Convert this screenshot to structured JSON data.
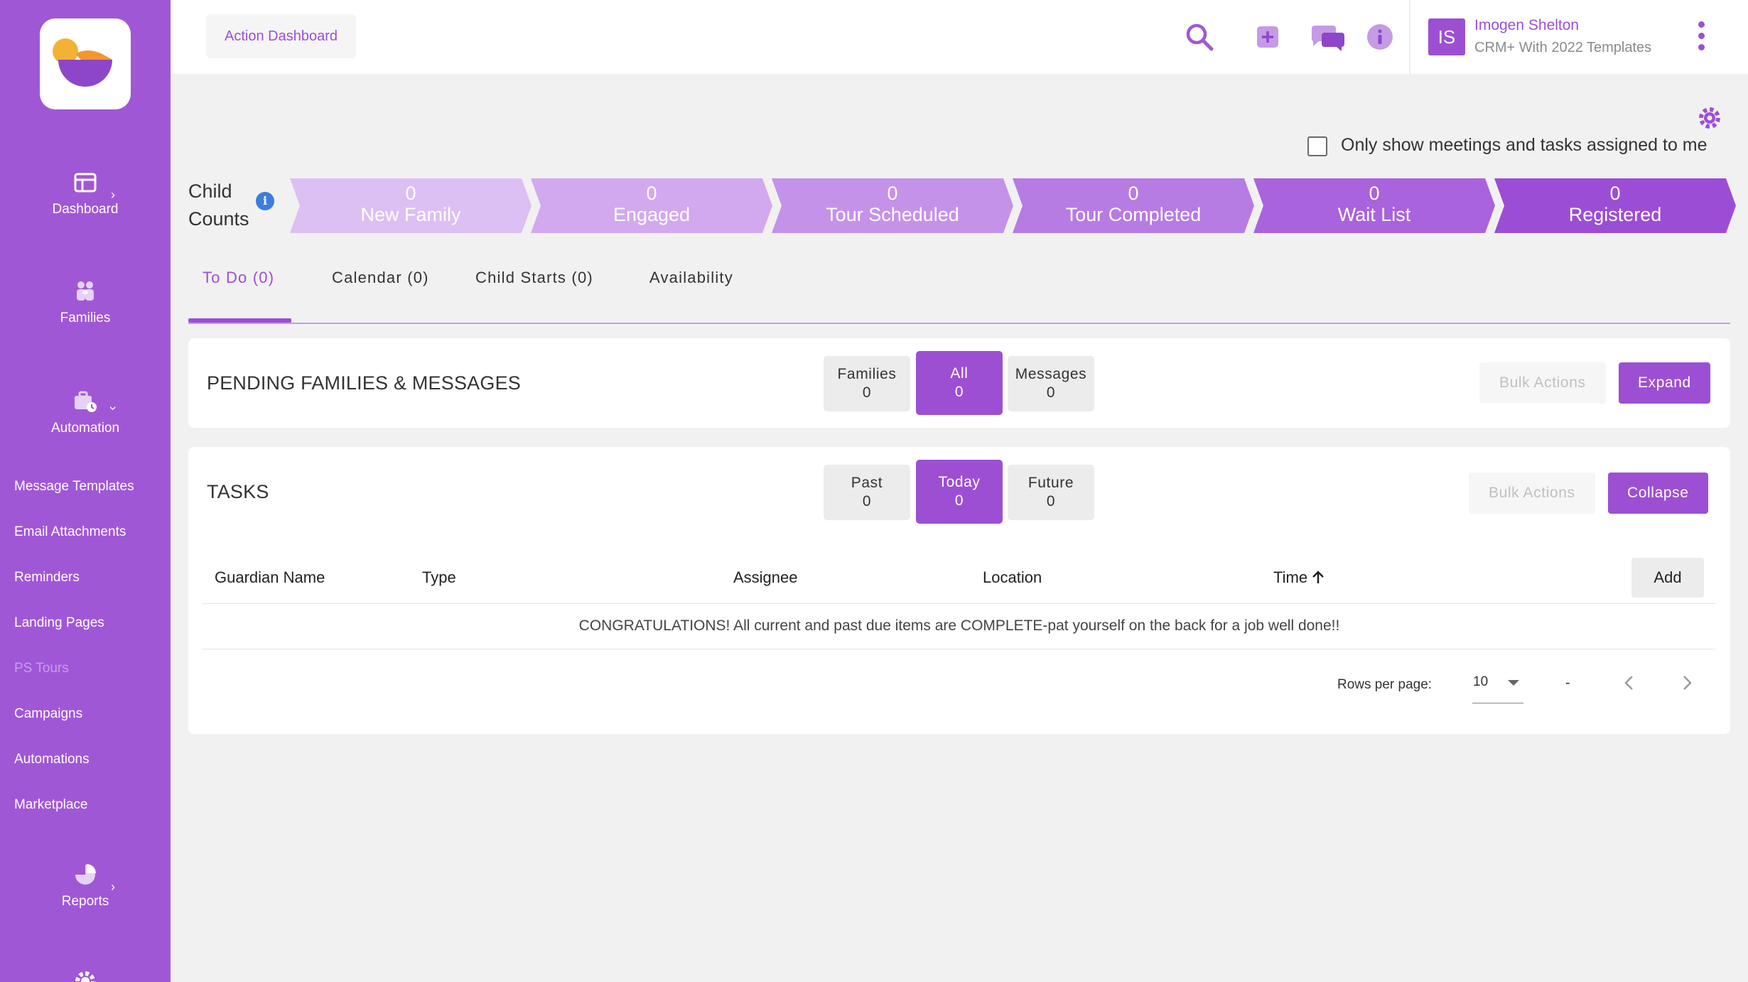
{
  "sidebar": {
    "main": [
      {
        "label": "Dashboard",
        "icon": "dashboard-icon"
      },
      {
        "label": "Families",
        "icon": "families-icon"
      },
      {
        "label": "Automation",
        "icon": "automation-icon"
      },
      {
        "label": "Reports",
        "icon": "reports-icon"
      }
    ],
    "sub": [
      "Message Templates",
      "Email Attachments",
      "Reminders",
      "Landing Pages",
      "PS Tours",
      "Campaigns",
      "Automations",
      "Marketplace"
    ]
  },
  "header": {
    "breadcrumb": "Action Dashboard",
    "user_initials": "IS",
    "user_name": "Imogen Shelton",
    "user_org": "CRM+ With 2022 Templates"
  },
  "filter": {
    "assigned_only_label": "Only show meetings and tasks assigned to me",
    "assigned_only_checked": false
  },
  "child_counts": {
    "title_line1": "Child",
    "title_line2": "Counts",
    "stages": [
      {
        "label": "New Family",
        "count": "0",
        "color": "#dcbff3"
      },
      {
        "label": "Engaged",
        "count": "0",
        "color": "#d2a9ee"
      },
      {
        "label": "Tour Scheduled",
        "count": "0",
        "color": "#c592e9"
      },
      {
        "label": "Tour Completed",
        "count": "0",
        "color": "#b77be4"
      },
      {
        "label": "Wait List",
        "count": "0",
        "color": "#a963dd"
      },
      {
        "label": "Registered",
        "count": "0",
        "color": "#9b4dd5"
      }
    ]
  },
  "tabs": [
    "To Do (0)",
    "Calendar (0)",
    "Child Starts (0)",
    "Availability"
  ],
  "pending": {
    "title": "PENDING FAMILIES & MESSAGES",
    "segments": [
      {
        "label": "Families",
        "count": "0"
      },
      {
        "label": "All",
        "count": "0"
      },
      {
        "label": "Messages",
        "count": "0"
      }
    ],
    "bulk_label": "Bulk Actions",
    "expand_label": "Expand"
  },
  "tasks": {
    "title": "TASKS",
    "segments": [
      {
        "label": "Past",
        "count": "0"
      },
      {
        "label": "Today",
        "count": "0"
      },
      {
        "label": "Future",
        "count": "0"
      }
    ],
    "bulk_label": "Bulk Actions",
    "collapse_label": "Collapse",
    "columns": [
      "Guardian Name",
      "Type",
      "Assignee",
      "Location",
      "Time"
    ],
    "add_label": "Add",
    "empty_message": "CONGRATULATIONS! All current and past due items are COMPLETE-pat yourself on the back for a job well done!!",
    "rows_per_page_label": "Rows per page:",
    "rows_per_page": "10",
    "range": "-"
  },
  "colors": {
    "brand": "#9c4fd3",
    "sidebar": "#a057d6"
  }
}
